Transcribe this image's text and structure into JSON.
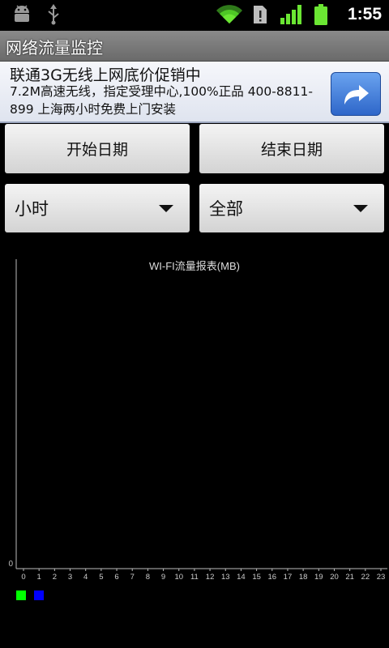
{
  "status_bar": {
    "time": "1:55",
    "icons": [
      "android-debug-icon",
      "usb-icon",
      "wifi-icon",
      "sim-alert-icon",
      "signal-icon",
      "battery-icon"
    ]
  },
  "app_title": "网络流量监控",
  "ad": {
    "title": "联通3G无线上网底价促销中",
    "description": "7.2M高速无线，指定受理中心,100%正品 400-8811-899 上海两小时免费上门安装",
    "action_icon": "share-arrow-icon"
  },
  "buttons": {
    "start_date": "开始日期",
    "end_date": "结束日期"
  },
  "spinners": {
    "unit": "小时",
    "scope": "全部"
  },
  "chart_data": {
    "type": "line",
    "title": "WI-FI流量报表(MB)",
    "x": [
      "0",
      "1",
      "2",
      "3",
      "4",
      "5",
      "6",
      "7",
      "8",
      "9",
      "10",
      "11",
      "12",
      "13",
      "14",
      "15",
      "16",
      "17",
      "18",
      "19",
      "20",
      "21",
      "22",
      "23"
    ],
    "y_tick_labels": [
      "0"
    ],
    "series": [
      {
        "color": "#00ff00",
        "values": []
      },
      {
        "color": "#0000ff",
        "values": []
      }
    ]
  },
  "colors": {
    "legend_green": "#00ff00",
    "legend_blue": "#0000ff",
    "ad_button": "#3a76d8"
  }
}
